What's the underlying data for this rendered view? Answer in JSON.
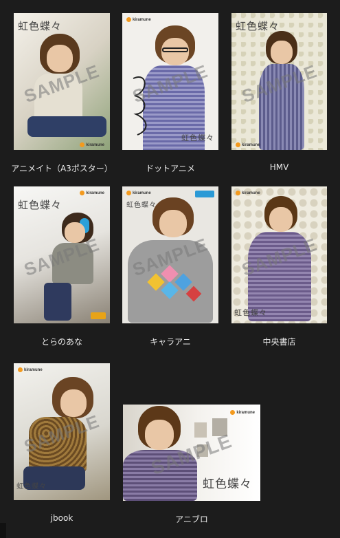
{
  "items": [
    {
      "caption": "アニメイト（A3ポスター）",
      "brand": "虹色蝶々",
      "logo": "kiramune",
      "watermark": "SAMPLE"
    },
    {
      "caption": "ドットアニメ",
      "brand": "虹色蝶々",
      "logo": "kiramune",
      "watermark": "SAMPLE"
    },
    {
      "caption": "HMV",
      "brand": "虹色蝶々",
      "logo": "kiramune",
      "watermark": "SAMPLE"
    },
    {
      "caption": "とらのあな",
      "brand": "虹色蝶々",
      "logo": "kiramune",
      "watermark": "SAMPLE"
    },
    {
      "caption": "キャラアニ",
      "brand": "虹色蝶々",
      "logo": "kiramune",
      "watermark": "SAMPLE"
    },
    {
      "caption": "中央書店",
      "brand": "虹色蝶々",
      "logo": "kiramune",
      "watermark": "SAMPLE"
    },
    {
      "caption": "jbook",
      "brand": "虹色蝶々",
      "logo": "kiramune",
      "watermark": "SAMPLE"
    },
    {
      "caption": "アニブロ",
      "brand": "虹色蝶々",
      "logo": "kiramune",
      "watermark": "SAMPLE"
    }
  ]
}
